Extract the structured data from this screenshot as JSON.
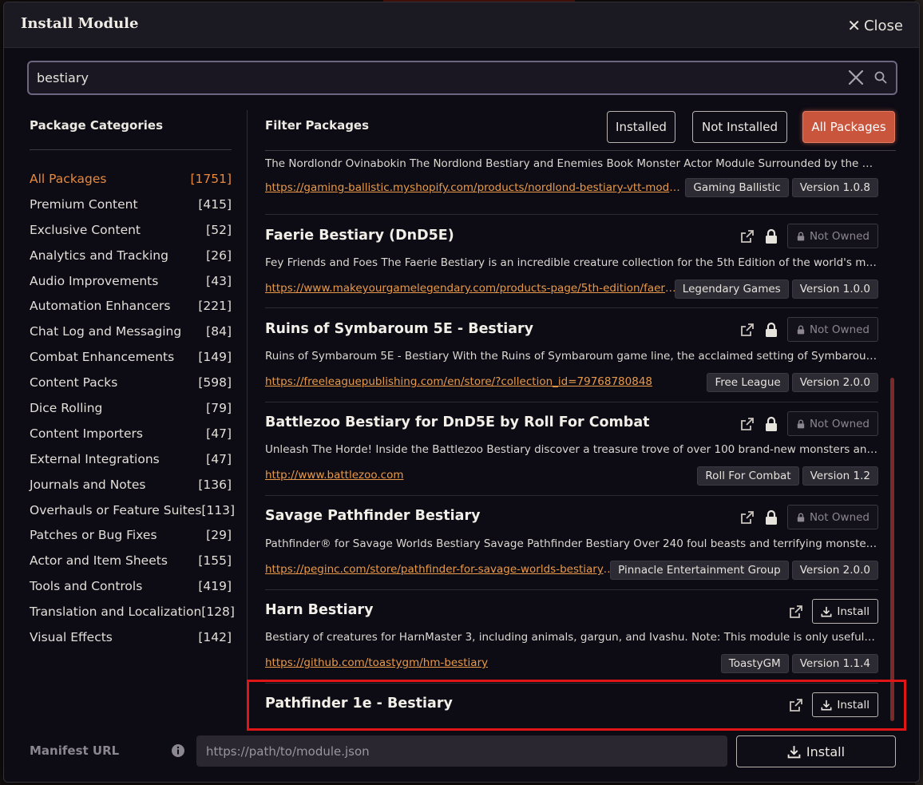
{
  "dialog": {
    "title": "Install Module",
    "close_label": "Close"
  },
  "search": {
    "value": "bestiary"
  },
  "sidebar": {
    "heading": "Package Categories",
    "categories": [
      {
        "label": "All Packages",
        "count": "[1751]",
        "active": true
      },
      {
        "label": "Premium Content",
        "count": "[415]"
      },
      {
        "label": "Exclusive Content",
        "count": "[52]"
      },
      {
        "label": "Analytics and Tracking",
        "count": "[26]"
      },
      {
        "label": "Audio Improvements",
        "count": "[43]"
      },
      {
        "label": "Automation Enhancers",
        "count": "[221]"
      },
      {
        "label": "Chat Log and Messaging",
        "count": "[84]"
      },
      {
        "label": "Combat Enhancements",
        "count": "[149]"
      },
      {
        "label": "Content Packs",
        "count": "[598]"
      },
      {
        "label": "Dice Rolling",
        "count": "[79]"
      },
      {
        "label": "Content Importers",
        "count": "[47]"
      },
      {
        "label": "External Integrations",
        "count": "[47]"
      },
      {
        "label": "Journals and Notes",
        "count": "[136]"
      },
      {
        "label": "Overhauls or Feature Suites",
        "count": "[113]"
      },
      {
        "label": "Patches or Bug Fixes",
        "count": "[29]"
      },
      {
        "label": "Actor and Item Sheets",
        "count": "[155]"
      },
      {
        "label": "Tools and Controls",
        "count": "[419]"
      },
      {
        "label": "Translation and Localization",
        "count": "[128]"
      },
      {
        "label": "Visual Effects",
        "count": "[142]"
      }
    ]
  },
  "filter": {
    "heading": "Filter Packages",
    "installed": "Installed",
    "not_installed": "Not Installed",
    "all_packages": "All Packages"
  },
  "packages": [
    {
      "description": "The Nordlondr Ovinabokin The Nordlond Bestiary and Enemies Book Monster Actor Module Surrounded by the Dragong...",
      "url": "https://gaming-ballistic.myshopify.com/products/nordlond-bestiary-vtt-module",
      "author": "Gaming Ballistic",
      "version": "Version 1.0.8"
    },
    {
      "title": "Faerie Bestiary (DnD5E)",
      "status": "Not Owned",
      "description": "Fey Friends and Foes The Faerie Bestiary is an incredible creature collection for the 5th Edition of the world's most ...",
      "url": "https://www.makeyourgamelegendary.com/products-page/5th-edition/faerie-...",
      "author": "Legendary Games",
      "version": "Version 1.0.0"
    },
    {
      "title": "Ruins of Symbaroum 5E - Bestiary",
      "status": "Not Owned",
      "description": "Ruins of Symbaroum 5E - Bestiary With the Ruins of Symbaroum game line, the acclaimed setting of Symbaroum comes...",
      "url": "https://freeleaguepublishing.com/en/store/?collection_id=79768780848",
      "author": "Free League",
      "version": "Version 2.0.0"
    },
    {
      "title": "Battlezoo Bestiary for DnD5E by Roll For Combat",
      "status": "Not Owned",
      "description": "Unleash The Horde! Inside the Battlezoo Bestiary discover a treasure trove of over 100 brand-new monsters and villains...",
      "url": "http://www.battlezoo.com",
      "author": "Roll For Combat",
      "version": "Version 1.2"
    },
    {
      "title": "Savage Pathfinder Bestiary",
      "status": "Not Owned",
      "description": "Pathfinder® for Savage Worlds Bestiary Savage Pathfinder Bestiary Over 240 foul beasts and terrifying monsters to pla...",
      "url": "https://peginc.com/store/pathfinder-for-savage-worlds-bestiary-f...",
      "author": "Pinnacle Entertainment Group",
      "version": "Version 2.0.0"
    },
    {
      "title": "Harn Bestiary",
      "install_label": "Install",
      "description": "Bestiary of creatures for HarnMaster 3, including animals, gargun, and Ivashu. Note: This module is only useful with th...",
      "url": "https://github.com/toastygm/hm-bestiary",
      "author": "ToastyGM",
      "version": "Version 1.1.4"
    },
    {
      "title": "Pathfinder 1e - Bestiary",
      "install_label": "Install"
    }
  ],
  "footer": {
    "manifest_label": "Manifest URL",
    "manifest_placeholder": "https://path/to/module.json",
    "install_label": "Install"
  },
  "colors": {
    "accent": "#e88a3c",
    "active_filter": "#c8553c",
    "highlight": "#e01515"
  }
}
